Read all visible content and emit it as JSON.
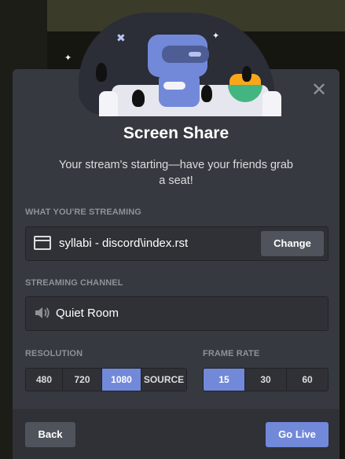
{
  "modal": {
    "title": "Screen Share",
    "subtitle": "Your stream's starting—have your friends grab a seat!",
    "close_icon": "close-icon"
  },
  "streaming": {
    "label": "WHAT YOU'RE STREAMING",
    "source": "syllabi - discord\\index.rst",
    "source_icon": "window-icon",
    "change_label": "Change"
  },
  "channel": {
    "label": "STREAMING CHANNEL",
    "name": "Quiet Room",
    "icon": "speaker-icon"
  },
  "resolution": {
    "label": "RESOLUTION",
    "options": [
      "480",
      "720",
      "1080",
      "SOURCE"
    ],
    "selected": "1080"
  },
  "frame_rate": {
    "label": "FRAME RATE",
    "options": [
      "15",
      "30",
      "60"
    ],
    "selected": "15"
  },
  "footer": {
    "back_label": "Back",
    "go_live_label": "Go Live"
  },
  "colors": {
    "accent": "#7289da",
    "modal_bg": "#36393f",
    "footer_bg": "#2f3136"
  }
}
